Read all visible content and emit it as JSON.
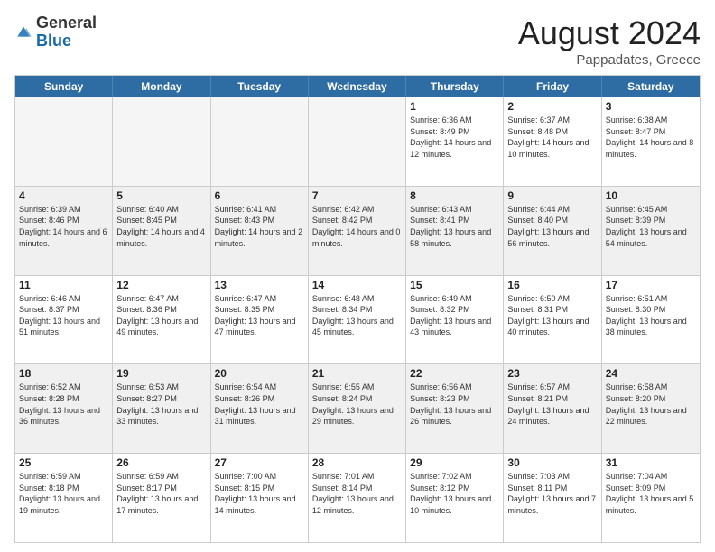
{
  "header": {
    "logo_general": "General",
    "logo_blue": "Blue",
    "title": "August 2024",
    "subtitle": "Pappadates, Greece"
  },
  "days_of_week": [
    "Sunday",
    "Monday",
    "Tuesday",
    "Wednesday",
    "Thursday",
    "Friday",
    "Saturday"
  ],
  "weeks": [
    [
      {
        "day": "",
        "text": "",
        "empty": true
      },
      {
        "day": "",
        "text": "",
        "empty": true
      },
      {
        "day": "",
        "text": "",
        "empty": true
      },
      {
        "day": "",
        "text": "",
        "empty": true
      },
      {
        "day": "1",
        "text": "Sunrise: 6:36 AM\nSunset: 8:49 PM\nDaylight: 14 hours\nand 12 minutes.",
        "empty": false
      },
      {
        "day": "2",
        "text": "Sunrise: 6:37 AM\nSunset: 8:48 PM\nDaylight: 14 hours\nand 10 minutes.",
        "empty": false
      },
      {
        "day": "3",
        "text": "Sunrise: 6:38 AM\nSunset: 8:47 PM\nDaylight: 14 hours\nand 8 minutes.",
        "empty": false
      }
    ],
    [
      {
        "day": "4",
        "text": "Sunrise: 6:39 AM\nSunset: 8:46 PM\nDaylight: 14 hours\nand 6 minutes.",
        "empty": false
      },
      {
        "day": "5",
        "text": "Sunrise: 6:40 AM\nSunset: 8:45 PM\nDaylight: 14 hours\nand 4 minutes.",
        "empty": false
      },
      {
        "day": "6",
        "text": "Sunrise: 6:41 AM\nSunset: 8:43 PM\nDaylight: 14 hours\nand 2 minutes.",
        "empty": false
      },
      {
        "day": "7",
        "text": "Sunrise: 6:42 AM\nSunset: 8:42 PM\nDaylight: 14 hours\nand 0 minutes.",
        "empty": false
      },
      {
        "day": "8",
        "text": "Sunrise: 6:43 AM\nSunset: 8:41 PM\nDaylight: 13 hours\nand 58 minutes.",
        "empty": false
      },
      {
        "day": "9",
        "text": "Sunrise: 6:44 AM\nSunset: 8:40 PM\nDaylight: 13 hours\nand 56 minutes.",
        "empty": false
      },
      {
        "day": "10",
        "text": "Sunrise: 6:45 AM\nSunset: 8:39 PM\nDaylight: 13 hours\nand 54 minutes.",
        "empty": false
      }
    ],
    [
      {
        "day": "11",
        "text": "Sunrise: 6:46 AM\nSunset: 8:37 PM\nDaylight: 13 hours\nand 51 minutes.",
        "empty": false
      },
      {
        "day": "12",
        "text": "Sunrise: 6:47 AM\nSunset: 8:36 PM\nDaylight: 13 hours\nand 49 minutes.",
        "empty": false
      },
      {
        "day": "13",
        "text": "Sunrise: 6:47 AM\nSunset: 8:35 PM\nDaylight: 13 hours\nand 47 minutes.",
        "empty": false
      },
      {
        "day": "14",
        "text": "Sunrise: 6:48 AM\nSunset: 8:34 PM\nDaylight: 13 hours\nand 45 minutes.",
        "empty": false
      },
      {
        "day": "15",
        "text": "Sunrise: 6:49 AM\nSunset: 8:32 PM\nDaylight: 13 hours\nand 43 minutes.",
        "empty": false
      },
      {
        "day": "16",
        "text": "Sunrise: 6:50 AM\nSunset: 8:31 PM\nDaylight: 13 hours\nand 40 minutes.",
        "empty": false
      },
      {
        "day": "17",
        "text": "Sunrise: 6:51 AM\nSunset: 8:30 PM\nDaylight: 13 hours\nand 38 minutes.",
        "empty": false
      }
    ],
    [
      {
        "day": "18",
        "text": "Sunrise: 6:52 AM\nSunset: 8:28 PM\nDaylight: 13 hours\nand 36 minutes.",
        "empty": false
      },
      {
        "day": "19",
        "text": "Sunrise: 6:53 AM\nSunset: 8:27 PM\nDaylight: 13 hours\nand 33 minutes.",
        "empty": false
      },
      {
        "day": "20",
        "text": "Sunrise: 6:54 AM\nSunset: 8:26 PM\nDaylight: 13 hours\nand 31 minutes.",
        "empty": false
      },
      {
        "day": "21",
        "text": "Sunrise: 6:55 AM\nSunset: 8:24 PM\nDaylight: 13 hours\nand 29 minutes.",
        "empty": false
      },
      {
        "day": "22",
        "text": "Sunrise: 6:56 AM\nSunset: 8:23 PM\nDaylight: 13 hours\nand 26 minutes.",
        "empty": false
      },
      {
        "day": "23",
        "text": "Sunrise: 6:57 AM\nSunset: 8:21 PM\nDaylight: 13 hours\nand 24 minutes.",
        "empty": false
      },
      {
        "day": "24",
        "text": "Sunrise: 6:58 AM\nSunset: 8:20 PM\nDaylight: 13 hours\nand 22 minutes.",
        "empty": false
      }
    ],
    [
      {
        "day": "25",
        "text": "Sunrise: 6:59 AM\nSunset: 8:18 PM\nDaylight: 13 hours\nand 19 minutes.",
        "empty": false
      },
      {
        "day": "26",
        "text": "Sunrise: 6:59 AM\nSunset: 8:17 PM\nDaylight: 13 hours\nand 17 minutes.",
        "empty": false
      },
      {
        "day": "27",
        "text": "Sunrise: 7:00 AM\nSunset: 8:15 PM\nDaylight: 13 hours\nand 14 minutes.",
        "empty": false
      },
      {
        "day": "28",
        "text": "Sunrise: 7:01 AM\nSunset: 8:14 PM\nDaylight: 13 hours\nand 12 minutes.",
        "empty": false
      },
      {
        "day": "29",
        "text": "Sunrise: 7:02 AM\nSunset: 8:12 PM\nDaylight: 13 hours\nand 10 minutes.",
        "empty": false
      },
      {
        "day": "30",
        "text": "Sunrise: 7:03 AM\nSunset: 8:11 PM\nDaylight: 13 hours\nand 7 minutes.",
        "empty": false
      },
      {
        "day": "31",
        "text": "Sunrise: 7:04 AM\nSunset: 8:09 PM\nDaylight: 13 hours\nand 5 minutes.",
        "empty": false
      }
    ]
  ]
}
